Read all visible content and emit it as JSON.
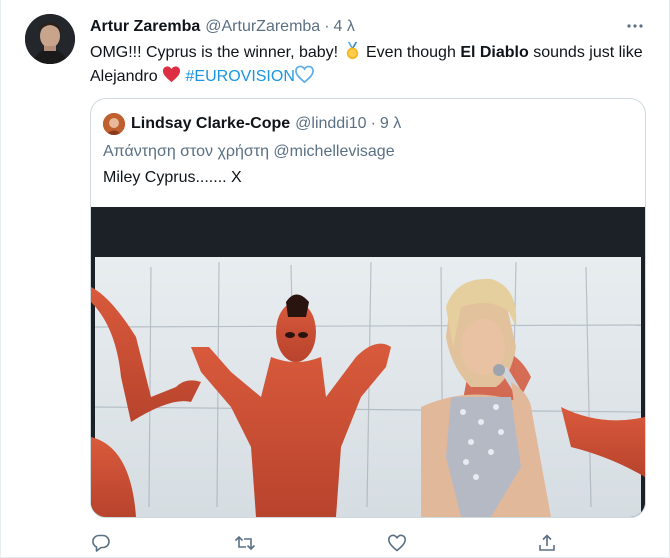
{
  "tweet": {
    "author_name": "Artur Zaremba",
    "author_handle": "@ArturZaremba",
    "separator": "·",
    "time": "4 λ",
    "text_part1": "OMG!!! Cyprus is the winner, baby!",
    "text_part2": "Even though",
    "text_bold": "El Diablo",
    "text_part3": "sounds just like Alejandro",
    "hashtag": "#EUROVISION",
    "more_icon": "more-horizontal-icon"
  },
  "quoted": {
    "author_name": "Lindsay Clarke-Cope",
    "author_handle": "@linddi10",
    "separator": "·",
    "time": "9 λ",
    "reply_line": "Απάντηση στον χρήστη @michellevisage",
    "text": "Miley Cyprus....... X"
  },
  "actions": {
    "icons": [
      "reply-icon",
      "retweet-icon",
      "like-icon",
      "share-icon"
    ]
  },
  "colors": {
    "link": "#1b95e0",
    "secondary_text": "#5b7083",
    "heart": "#e0245e",
    "blue_heart": "#5dadec",
    "medal": "#f5b51d"
  }
}
